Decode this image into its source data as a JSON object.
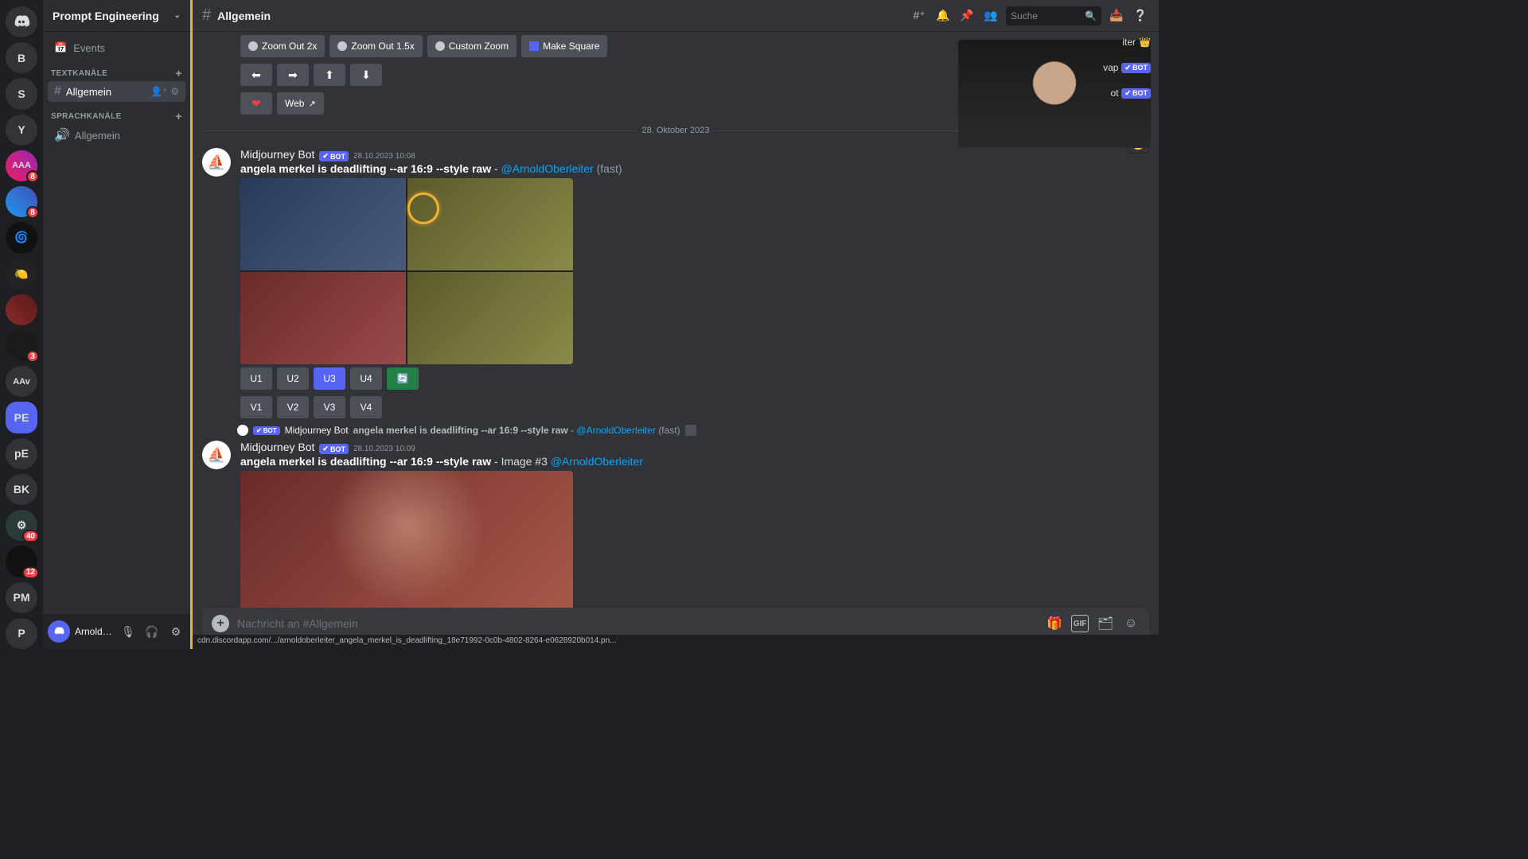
{
  "server_header": {
    "name": "Prompt Engineering"
  },
  "channel": {
    "name": "Allgemein"
  },
  "sidebar": {
    "events": "Events",
    "cat_text": "TEXTKANÄLE",
    "cat_voice": "SPRACHKANÄLE",
    "text_channels": [
      {
        "label": "Allgemein"
      }
    ],
    "voice_channels": [
      {
        "label": "Allgemein"
      }
    ]
  },
  "user_panel": {
    "name": "ArnoldOb..."
  },
  "header": {
    "search_placeholder": "Suche"
  },
  "servers": [
    "B",
    "S",
    "Y",
    "AAA",
    "",
    "",
    "",
    "",
    "",
    "",
    "AAv",
    "PE",
    "pE",
    "BK",
    "",
    "",
    "PM",
    "P"
  ],
  "server_badges": {
    "3": "8",
    "4": "8",
    "9": "3",
    "15": "40",
    "16": "12"
  },
  "top_buttons": {
    "zoom2x": "Zoom Out 2x",
    "zoom15x": "Zoom Out 1.5x",
    "custom": "Custom Zoom",
    "square": "Make Square",
    "web": "Web"
  },
  "divider_date": "28. Oktober 2023",
  "msg1": {
    "author": "Midjourney Bot",
    "bot": "BOT",
    "ts": "28.10.2023 10:08",
    "prompt_bold": "angela merkel is deadlifting --ar 16:9 --style raw",
    "mention": "@ArnoldOberleiter",
    "suffix": "(fast)",
    "u1": "U1",
    "u2": "U2",
    "u3": "U3",
    "u4": "U4",
    "v1": "V1",
    "v2": "V2",
    "v3": "V3",
    "v4": "V4"
  },
  "reply": {
    "author": "Midjourney Bot",
    "bot": "BOT",
    "text": "angela merkel is deadlifting --ar 16:9 --style raw",
    "mention": "@ArnoldOberleiter",
    "suffix": "(fast)"
  },
  "msg2": {
    "author": "Midjourney Bot",
    "bot": "BOT",
    "ts": "28.10.2023 10:09",
    "prompt_bold": "angela merkel is deadlifting --ar 16:9 --style raw",
    "image_label": "Image #3",
    "mention": "@ArnoldOberleiter"
  },
  "input": {
    "placeholder": "Nachricht an #Allgemein"
  },
  "status_url": "cdn.discordapp.com/.../arnoldoberleiter_angela_merkel_is_deadlifting_18e71992-0c0b-4802-8264-e0628920b014.pn...",
  "member_suffix": {
    "leader": "iter",
    "swap": "vap",
    "bot": "ot",
    "bot_tag": "BOT"
  }
}
